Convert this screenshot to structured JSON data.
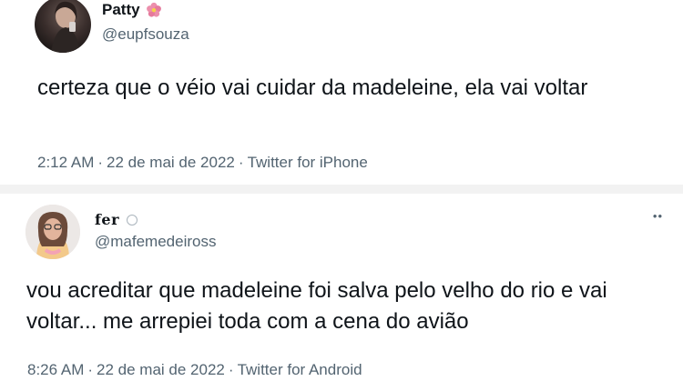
{
  "tweets": [
    {
      "display_name": "Patty",
      "name_emoji_icon": "hibiscus-flower-icon",
      "handle": "@eupfsouza",
      "text": "certeza que o véio vai cuidar da madeleine, ela vai voltar",
      "time": "2:12 AM",
      "date": "22 de mai de 2022",
      "source": "Twitter for iPhone"
    },
    {
      "display_name": "fer",
      "name_badge_icon": "small-circle-icon",
      "handle": "@mafemedeiross",
      "text": "vou acreditar que madeleine foi salva pelo velho do rio e vai voltar... me arrepiei toda com a cena do avião",
      "time": "8:26 AM",
      "date": "22 de mai de 2022",
      "source": "Twitter for Android",
      "more_icon": "more-options-icon"
    }
  ],
  "separator": "·",
  "colors": {
    "text_primary": "#0f1419",
    "text_secondary": "#536471",
    "divider": "#f2f2f2",
    "flower": "#e8799a"
  }
}
